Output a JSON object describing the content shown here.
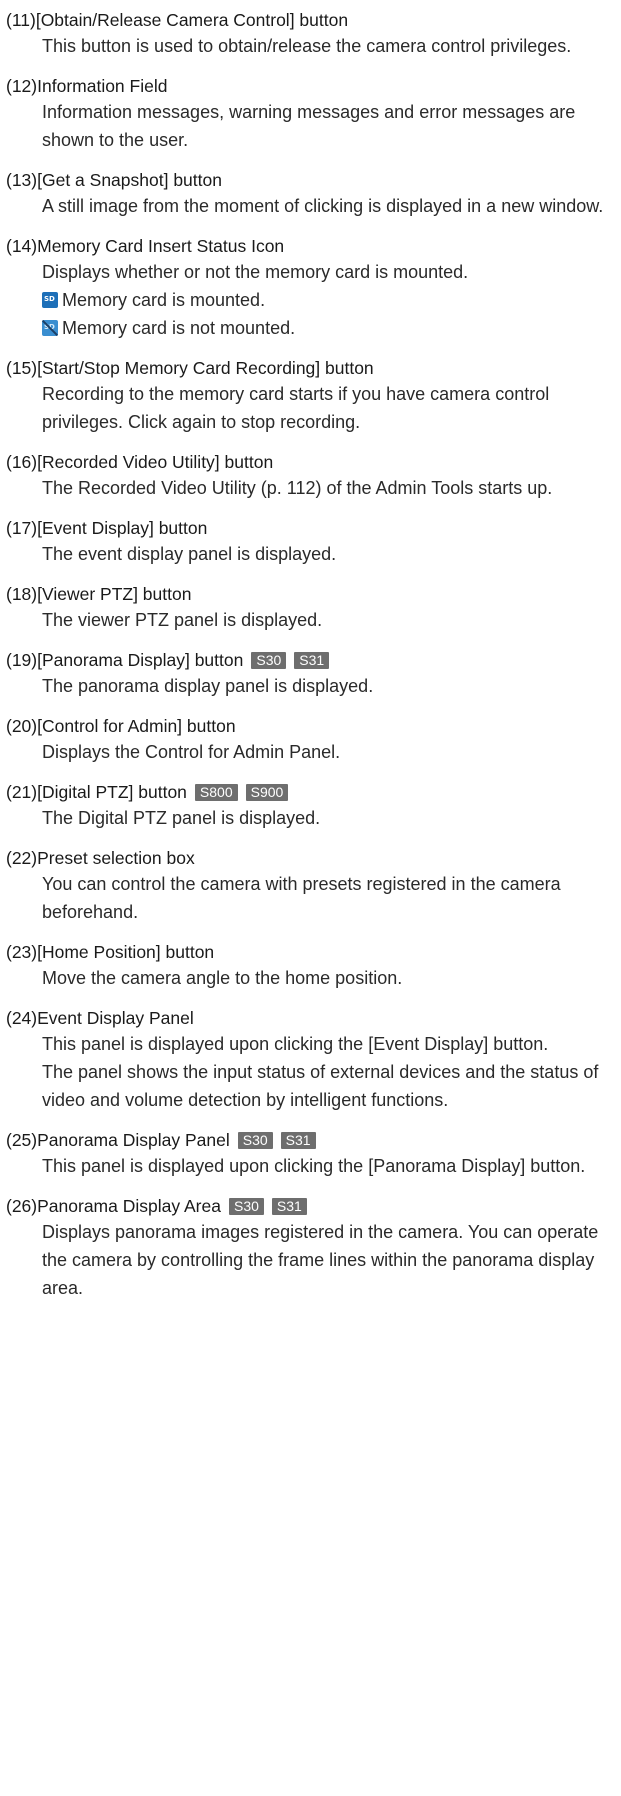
{
  "entries": [
    {
      "num": "(11)",
      "title": "[Obtain/Release Camera Control] button",
      "tags": [],
      "paras": [
        "This button is used to obtain/release the camera control privileges."
      ]
    },
    {
      "num": "(12)",
      "title": "Information Field",
      "tags": [],
      "paras": [
        "Information messages, warning messages and error messages are shown to the user."
      ]
    },
    {
      "num": "(13)",
      "title": "[Get a Snapshot] button",
      "tags": [],
      "paras": [
        "A still image from the moment of clicking is displayed in a new window."
      ]
    },
    {
      "num": "(14)",
      "title": "Memory Card Insert Status Icon",
      "tags": [],
      "paras": [
        "Displays whether or not the memory card is mounted."
      ],
      "icon_lines": [
        {
          "icon": "sd-card-mounted-icon",
          "text": "Memory card is mounted."
        },
        {
          "icon": "sd-card-not-mounted-icon",
          "text": "Memory card is not mounted."
        }
      ]
    },
    {
      "num": "(15)",
      "title": "[Start/Stop Memory Card Recording] button",
      "tags": [],
      "paras": [
        "Recording to the memory card starts if you have camera control privileges. Click again to stop recording."
      ]
    },
    {
      "num": "(16)",
      "title": "[Recorded Video Utility] button",
      "tags": [],
      "paras": [
        "The Recorded Video Utility (p. 112) of the Admin Tools starts up."
      ]
    },
    {
      "num": "(17)",
      "title": "[Event Display] button",
      "tags": [],
      "paras": [
        "The event display panel is displayed."
      ]
    },
    {
      "num": "(18)",
      "title": "[Viewer PTZ] button",
      "tags": [],
      "paras": [
        "The viewer PTZ panel is displayed."
      ]
    },
    {
      "num": "(19)",
      "title": "[Panorama Display] button",
      "tags": [
        "S30",
        "S31"
      ],
      "paras": [
        "The panorama display panel is displayed."
      ]
    },
    {
      "num": "(20)",
      "title": "[Control for Admin] button",
      "tags": [],
      "paras": [
        "Displays the Control for Admin Panel."
      ]
    },
    {
      "num": "(21)",
      "title": "[Digital PTZ] button",
      "tags": [
        "S800",
        "S900"
      ],
      "paras": [
        "The Digital PTZ panel is displayed."
      ]
    },
    {
      "num": "(22)",
      "title": "Preset selection box",
      "tags": [],
      "paras": [
        "You can control the camera with presets registered in the camera beforehand."
      ]
    },
    {
      "num": "(23)",
      "title": "[Home Position] button",
      "tags": [],
      "paras": [
        "Move the camera angle to the home position."
      ]
    },
    {
      "num": "(24)",
      "title": "Event Display Panel",
      "tags": [],
      "paras": [
        "This panel is displayed upon clicking the [Event Display] button.",
        "The panel shows the input status of external devices and the status of video and volume detection by intelligent functions."
      ]
    },
    {
      "num": "(25)",
      "title": "Panorama Display Panel",
      "tags": [
        "S30",
        "S31"
      ],
      "paras": [
        "This panel is displayed upon clicking the [Panorama Display] button."
      ]
    },
    {
      "num": "(26)",
      "title": "Panorama Display Area",
      "tags": [
        "S30",
        "S31"
      ],
      "paras": [
        "Displays panorama images registered in the camera. You can operate the camera by controlling the frame lines within the panorama display area."
      ]
    }
  ]
}
